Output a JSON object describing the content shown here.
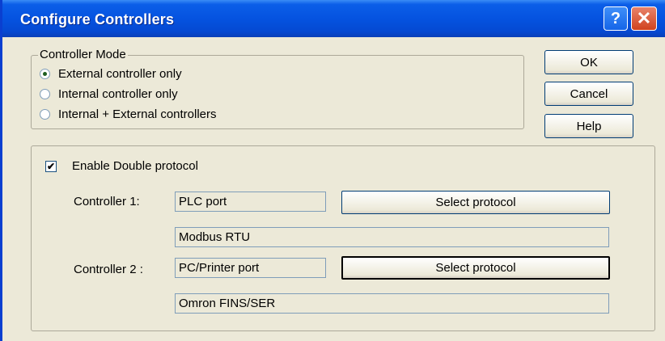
{
  "window": {
    "title": "Configure Controllers",
    "help_glyph": "?",
    "close_glyph": "✕"
  },
  "controller_mode": {
    "label": "Controller Mode",
    "options": [
      {
        "label": "External controller only",
        "selected": true
      },
      {
        "label": "Internal controller only",
        "selected": false
      },
      {
        "label": "Internal + External controllers",
        "selected": false
      }
    ]
  },
  "buttons": {
    "ok": "OK",
    "cancel": "Cancel",
    "help": "Help"
  },
  "double_protocol": {
    "checkbox_label": "Enable Double protocol",
    "checked": true,
    "check_glyph": "✔",
    "controller1": {
      "label": "Controller 1:",
      "port": "PLC port",
      "select_label": "Select protocol",
      "protocol": "Modbus RTU"
    },
    "controller2": {
      "label": "Controller 2 :",
      "port": "PC/Printer port",
      "select_label": "Select protocol",
      "protocol": "Omron FINS/SER"
    }
  },
  "colors": {
    "titlebar": "#0553e0",
    "dialog_bg": "#ece9d8",
    "close_button": "#d0431e"
  }
}
